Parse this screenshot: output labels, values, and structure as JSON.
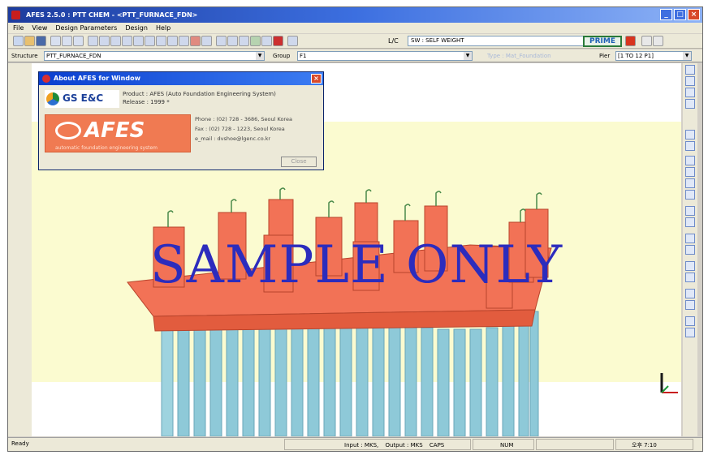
{
  "window": {
    "title": "AFES 2.5.0 : PTT CHEM - <PTT_FURNACE_FDN>",
    "buttons": [
      "_",
      "□",
      "×"
    ]
  },
  "menu": [
    "File",
    "View",
    "Design Parameters",
    "Design",
    "Help"
  ],
  "toolbar": {
    "lc_label": "L/C",
    "lc_value": "SW : SELF WEIGHT",
    "prime_label": "PRIME"
  },
  "structure_bar": {
    "structure_label": "Structure",
    "structure_value": "PTT_FURNACE_FDN",
    "group_label": "Group",
    "group_value": "F1",
    "type_text": "Type : Mat_Foundation",
    "pier_label": "Pier",
    "pier_value": "[1 TO 12 P1]"
  },
  "about_dialog": {
    "title": "About AFES for Window",
    "logo_text": "GS E&C",
    "product_line": "Product : AFES (Auto Foundation Engineering System)",
    "release_line": "Release : 1999 *",
    "banner_big": "AFES",
    "banner_sub": "automatic foundation engineering system",
    "phone": "Phone : (02) 728 - 3686, Seoul Korea",
    "fax": "Fax : (02) 728 - 1223, Seoul Korea",
    "email": "e_mail : dvshoe@lgenc.co.kr",
    "close_label": "Close"
  },
  "watermark": "SAMPLE ONLY",
  "statusbar": {
    "ready": "Ready",
    "input_units": "Input : MKS,",
    "output_units": "Output : MKS",
    "caps": "CAPS",
    "num": "NUM",
    "clock": "오후 7:10"
  },
  "colors": {
    "pile_cap": "#f27256",
    "pile": "#8ec9d8",
    "band": "#fbfbd0",
    "watermark": "#2c2cbd"
  }
}
